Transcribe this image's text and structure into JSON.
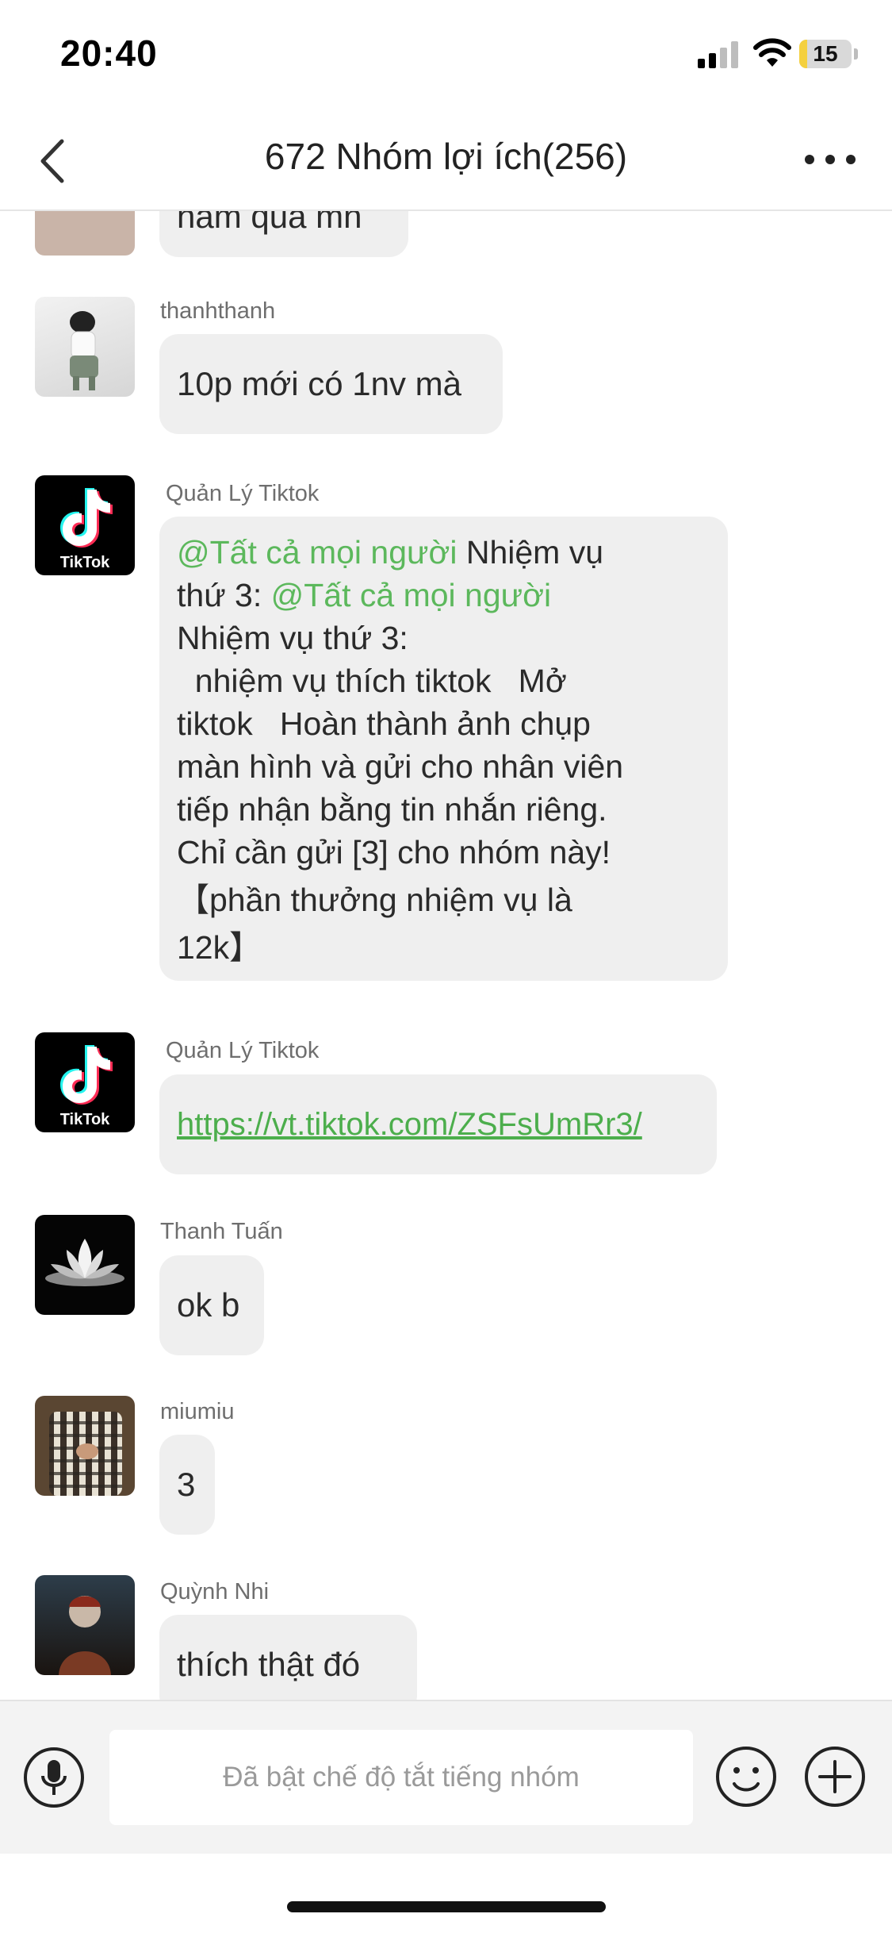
{
  "status_bar": {
    "time": "20:40",
    "battery": "15",
    "battery_level": 0.15
  },
  "header": {
    "title": "672 Nhóm lợi ích(256)"
  },
  "messages": [
    {
      "id": "m0",
      "sender": "",
      "text": "nam qua mn"
    },
    {
      "id": "m1",
      "sender": "thanhthanh",
      "text": "10p mới có 1nv mà"
    },
    {
      "id": "m2",
      "sender": "Quản Lý Tiktok",
      "mention1": "@Tất cả mọi người",
      "text1": "   Nhiệm vụ",
      "text2": "thứ 3: ",
      "mention2": "@Tất cả mọi người",
      "line3": "Nhiệm vụ thứ 3:",
      "line4": "  nhiệm vụ thích tiktok   Mở",
      "line5": "tiktok   Hoàn thành ảnh chụp",
      "line6": "màn hình và gửi cho nhân viên",
      "line7": "tiếp nhận bằng tin nhắn riêng.",
      "line8": "Chỉ cần gửi [3] cho nhóm này!",
      "line9": "【phần thưởng nhiệm vụ là",
      "line10": "12k】"
    },
    {
      "id": "m3",
      "sender": "Quản Lý Tiktok",
      "link": "https://vt.tiktok.com/ZSFsUmRr3/"
    },
    {
      "id": "m4",
      "sender": "Thanh Tuấn",
      "text": "ok b"
    },
    {
      "id": "m5",
      "sender": "miumiu",
      "text": "3"
    },
    {
      "id": "m6",
      "sender": "Quỳnh Nhi",
      "text": "thích thật đó"
    }
  ],
  "avatars": {
    "tiktok_logo_text": "TikTok"
  },
  "input": {
    "placeholder": "Đã bật chế độ tắt tiếng nhóm"
  },
  "colors": {
    "mention": "#5cb85c",
    "bubble": "#efefef",
    "battery": "#f4d03f"
  },
  "icons": [
    "back-icon",
    "more-icon",
    "mic-icon",
    "emoji-icon",
    "plus-icon",
    "wifi-icon",
    "signal-icon"
  ]
}
